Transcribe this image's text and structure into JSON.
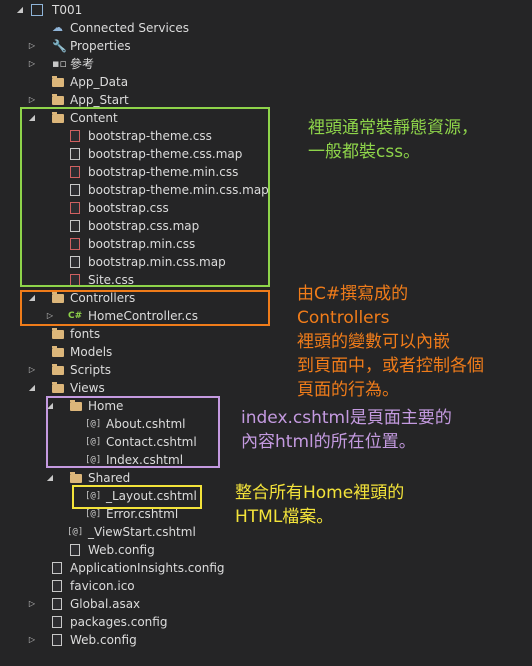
{
  "tree": {
    "project": "T001",
    "connected_services": "Connected Services",
    "properties": "Properties",
    "references": "參考",
    "app_data": "App_Data",
    "app_start": "App_Start",
    "content": {
      "label": "Content",
      "files": [
        "bootstrap-theme.css",
        "bootstrap-theme.css.map",
        "bootstrap-theme.min.css",
        "bootstrap-theme.min.css.map",
        "bootstrap.css",
        "bootstrap.css.map",
        "bootstrap.min.css",
        "bootstrap.min.css.map",
        "Site.css"
      ]
    },
    "controllers": {
      "label": "Controllers",
      "home_controller": "HomeController.cs",
      "csharp_glyph": "C#"
    },
    "fonts": "fonts",
    "models": "Models",
    "scripts": "Scripts",
    "views": {
      "label": "Views",
      "home": {
        "label": "Home",
        "files": [
          "About.cshtml",
          "Contact.cshtml",
          "Index.cshtml"
        ]
      },
      "shared": {
        "label": "Shared",
        "files": [
          "_Layout.cshtml",
          "Error.cshtml"
        ]
      },
      "viewstart": "_ViewStart.cshtml",
      "web_config": "Web.config"
    },
    "root_files": [
      "ApplicationInsights.config",
      "favicon.ico",
      "Global.asax",
      "packages.config",
      "Web.config"
    ],
    "razor_glyph": "[@]"
  },
  "annotations": {
    "content": "裡頭通常裝靜態資源，\n一般都裝css。",
    "controllers": "由C#撰寫成的\nControllers\n裡頭的變數可以內嵌\n到頁面中，或者控制各個\n頁面的行為。",
    "home": "index.cshtml是頁面主要的\n內容html的所在位置。",
    "layout": "整合所有Home裡頭的\nHTML檔案。"
  },
  "colors": {
    "green": "#8ed44a",
    "orange": "#f07c1a",
    "purple": "#c49ae0",
    "yellow": "#f3e33a"
  }
}
